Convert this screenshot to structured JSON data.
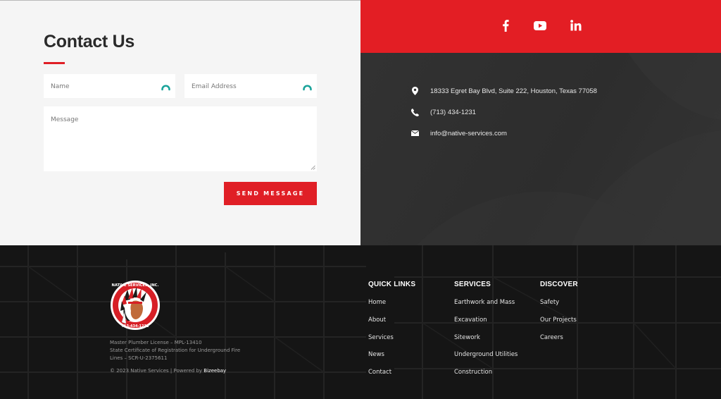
{
  "contact": {
    "title": "Contact Us",
    "name_placeholder": "Name",
    "email_placeholder": "Email Address",
    "message_placeholder": "Message",
    "send_label": "SEND MESSAGE"
  },
  "social": {
    "icons": [
      "facebook-icon",
      "youtube-icon",
      "linkedin-icon"
    ],
    "bar_color": "#e31e24"
  },
  "info": {
    "address": "18333 Egret Bay Blvd, Suite 222, Houston, Texas 77058",
    "phone": "(713) 434-1231",
    "email": "info@native-services.com"
  },
  "footer": {
    "logo_text_top": "NATIVE SERVICES, INC.",
    "logo_text_bottom": "713-434-1231",
    "license_1": "Master Plumber License – MPL-13410",
    "license_2": "State Certificate of Registration for Underground Fire Lines – SCR-U-2375611",
    "copyright": "© 2023 Native Services | Powered by ",
    "powered_brand": "Bizeebay",
    "columns": [
      {
        "heading": "QUICK LINKS",
        "items": [
          "Home",
          "About",
          "Services",
          "News",
          "Contact"
        ]
      },
      {
        "heading": "SERVICES",
        "items": [
          "Earthwork and Mass",
          "Excavation",
          "Sitework",
          "Underground Utilities",
          "Construction"
        ]
      },
      {
        "heading": "DISCOVER",
        "items": [
          "Safety",
          "Our Projects",
          "Careers"
        ]
      }
    ]
  },
  "colors": {
    "accent_red": "#e01f26",
    "info_bg": "#2f2f2f",
    "form_bg": "#f5f5f5",
    "autocomplete_icon": "#1aa39a"
  }
}
